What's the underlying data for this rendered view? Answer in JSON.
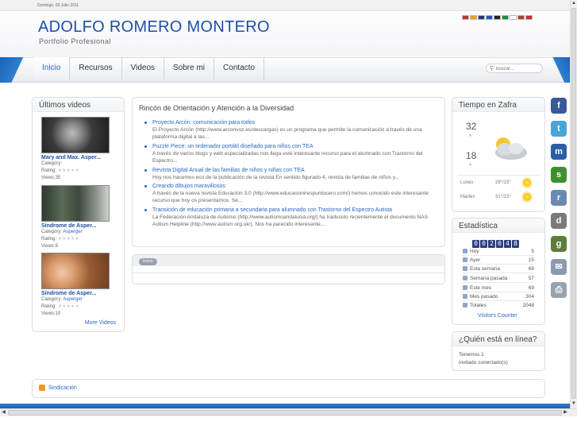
{
  "date": "Domingo, 03 Julio 2011",
  "site": {
    "title": "ADOLFO ROMERO MONTERO",
    "subtitle": "Portfolio Profesional"
  },
  "flags": [
    "#c0392b",
    "#e8a317",
    "#1f3a7a",
    "#2256c7",
    "#222222",
    "#1e8c3a",
    "#ffffff",
    "#c0392b",
    "#d7263d"
  ],
  "nav": {
    "items": [
      "Inicio",
      "Recursos",
      "Videos",
      "Sobre mi",
      "Contacto"
    ]
  },
  "search": {
    "placeholder": "buscar..."
  },
  "videos": {
    "title": "Últimos videos",
    "items": [
      {
        "title": "Mary and Max. Asper...",
        "category_label": "Category:",
        "category": "",
        "rating_label": "Rating:",
        "views": "Views:35"
      },
      {
        "title": "Síndrome de Asper...",
        "category_label": "Category:",
        "category": "Asperger",
        "rating_label": "Rating:",
        "views": "Views:8"
      },
      {
        "title": "Síndrome de Asper...",
        "category_label": "Category:",
        "category": "Asperger",
        "rating_label": "Rating:",
        "views": "Views:10"
      }
    ],
    "more": "More Videos"
  },
  "main": {
    "title": "Rincón de Orientación y Atención a la Diversidad",
    "articles": [
      {
        "title": "Proyecto Arcón: comunicación para todos",
        "desc": "El Proyecto Arcón (http://www.arconvoz.es/descargas) es un programa que permite la comunicación a través de una plataforma digital a las..."
      },
      {
        "title": "Puzzle Piece: un ordenador portátil diseñado para niños con TEA",
        "desc": "A través de varios blogs y web especializadas nos llega este interesante recurso para el alumnado con Trastorno del Espectro..."
      },
      {
        "title": "Revista Digital Anual de las familias de niños y niñas con TEA",
        "desc": "Hoy nos hacemos eco de la publicación de la revista En sentido figurado 4, revista de familias de niños y..."
      },
      {
        "title": "Creando dibujos maravillosos",
        "desc": "A través de la nueva revista Educación 3.0 (http://www.educacionirespuntocero.com/) hemos conocido este interesante recurso que hoy os presentamos. Se..."
      },
      {
        "title": "Transición de educación primaria a secundaria para alumnado con Trastorno del Espectro Autista",
        "desc": "La Federación Andaluza de Autismo (http://www.autismoandalucia.org/) ha traducido recientemente el documento NAS Autism Helpline (http://www.autism.org.uk/). Nos ha parecido interesante..."
      }
    ],
    "breadcrumb": "Inicio"
  },
  "weather": {
    "title": "Tiempo en Zafra",
    "high": "32",
    "low": "18",
    "deg": "°",
    "forecast": [
      {
        "day": "Lunes",
        "temps": "29°/15°"
      },
      {
        "day": "Martes",
        "temps": "31°/15°"
      }
    ]
  },
  "stats": {
    "title": "Estadística",
    "counter": [
      "0",
      "0",
      "2",
      "0",
      "4",
      "8"
    ],
    "rows": [
      {
        "label": "Hoy",
        "value": "5"
      },
      {
        "label": "Ayer",
        "value": "15"
      },
      {
        "label": "Esta semana",
        "value": "69"
      },
      {
        "label": "Semana pasada",
        "value": "57"
      },
      {
        "label": "Este mes",
        "value": "69"
      },
      {
        "label": "Mes pasado",
        "value": "304"
      },
      {
        "label": "Totales",
        "value": "2048"
      }
    ],
    "link": "Visitors Counter"
  },
  "online": {
    "title": "¿Quién está en línea?",
    "line1": "Tenemos 1",
    "line2": "invitado conectado(s)"
  },
  "footer": {
    "syndication": "Sindicación"
  },
  "social": [
    {
      "name": "facebook-icon",
      "glyph": "f",
      "color": "#3b5998"
    },
    {
      "name": "twitter-icon",
      "glyph": "t",
      "color": "#4aa5d8"
    },
    {
      "name": "myspace-icon",
      "glyph": "m",
      "color": "#2a5ea8"
    },
    {
      "name": "stumbleupon-icon",
      "glyph": "s",
      "color": "#3f8f2f"
    },
    {
      "name": "reddit-icon",
      "glyph": "r",
      "color": "#6c8ab0"
    },
    {
      "name": "delicious-icon",
      "glyph": "d",
      "color": "#7a7a7a"
    },
    {
      "name": "digg-icon",
      "glyph": "g",
      "color": "#5d7d3a"
    },
    {
      "name": "email-icon",
      "glyph": "✉",
      "color": "#8a9bb0"
    },
    {
      "name": "print-icon",
      "glyph": "⎙",
      "color": "#9aa3ad"
    }
  ]
}
